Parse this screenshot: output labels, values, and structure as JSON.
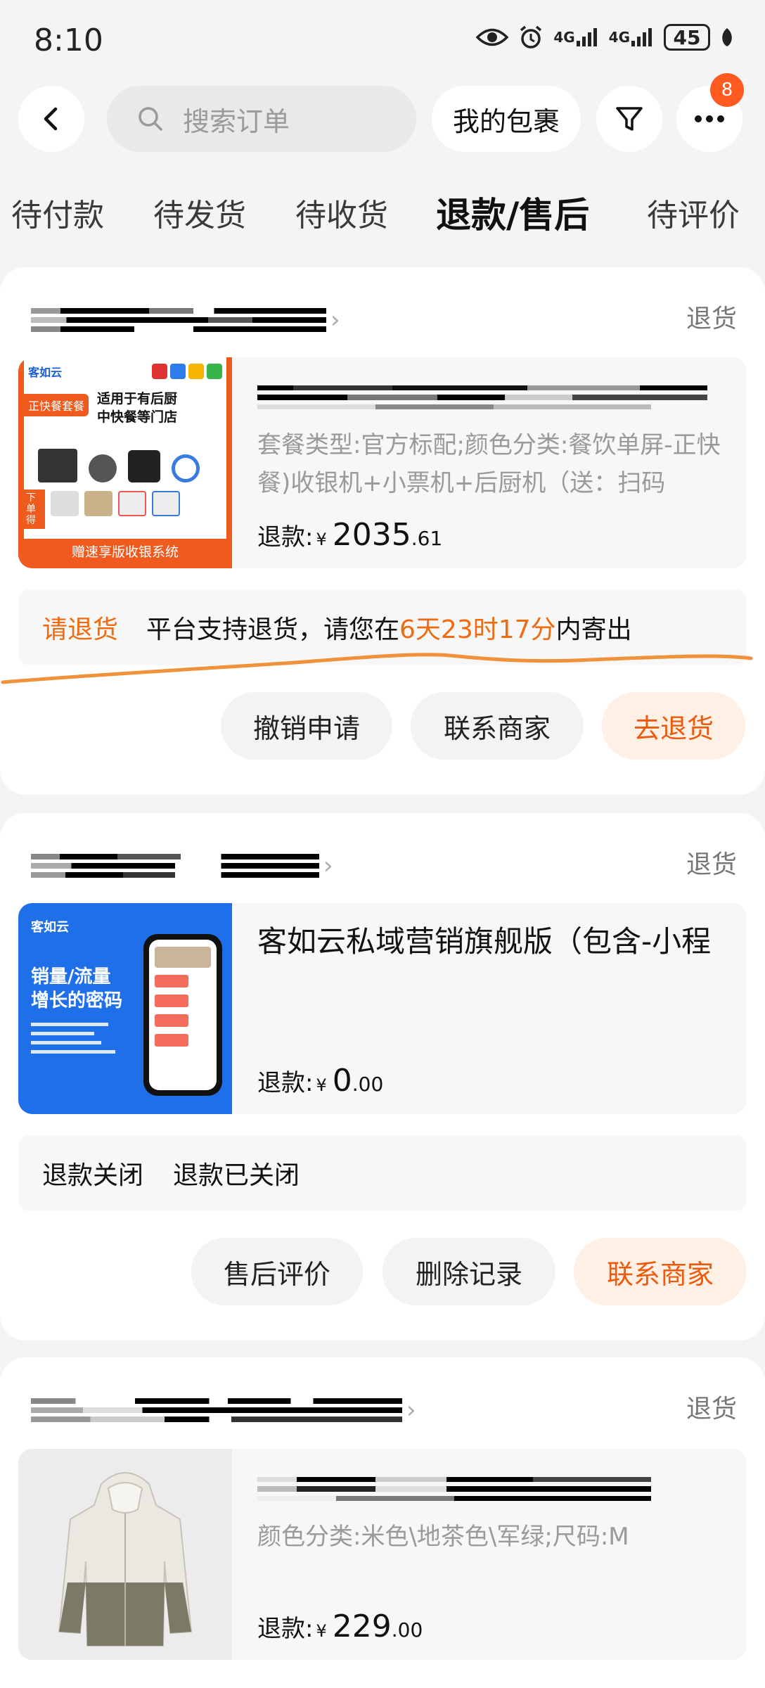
{
  "status_bar": {
    "time": "8:10",
    "net1": "4G",
    "net2": "4G",
    "battery": "45"
  },
  "header": {
    "search_placeholder": "搜索订单",
    "packages_label": "我的包裹",
    "more_badge": "8"
  },
  "tabs": [
    {
      "label": "待付款",
      "active": false
    },
    {
      "label": "待发货",
      "active": false
    },
    {
      "label": "待收货",
      "active": false
    },
    {
      "label": "退款/售后",
      "active": true
    },
    {
      "label": "待评价",
      "active": false
    }
  ],
  "orders": [
    {
      "refund_type": "退货",
      "thumb_text": {
        "brand": "客如云",
        "tag": "正快餐套餐",
        "headline1": "适用于有后厨",
        "headline2": "中快餐等门店",
        "cta": "下单得",
        "footer": "赠速享版收银系统"
      },
      "sku": "套餐类型:官方标配;颜色分类:餐饮单屏-正快餐)收银机+小票机+后厨机（送：扫码",
      "refund_label": "退款:",
      "currency": "¥",
      "amount_int": "2035",
      "amount_dec": ".61",
      "notice_status": "请退货",
      "notice_text_pre": "平台支持退货，请您在",
      "notice_highlight": "6天23时17分",
      "notice_text_post": "内寄出",
      "buttons": [
        "撤销申请",
        "联系商家",
        "去退货"
      ]
    },
    {
      "refund_type": "退货",
      "thumb_text": {
        "brand": "客如云",
        "headline1": "销量/流量",
        "headline2": "增长的密码"
      },
      "product_name": "客如云私域营销旗舰版（包含-小程",
      "refund_label": "退款:",
      "currency": "¥",
      "amount_int": "0",
      "amount_dec": ".00",
      "notice_status": "退款关闭",
      "notice_text": "退款已关闭",
      "buttons": [
        "售后评价",
        "删除记录",
        "联系商家"
      ]
    },
    {
      "refund_type": "退货",
      "sku": "颜色分类:米色\\地茶色\\军绿;尺码:M",
      "refund_label": "退款:",
      "currency": "¥",
      "amount_int": "229",
      "amount_dec": ".00"
    }
  ],
  "colors": {
    "accent": "#f06a10",
    "badge": "#ff5a1f",
    "annotation": "#f0923c"
  }
}
